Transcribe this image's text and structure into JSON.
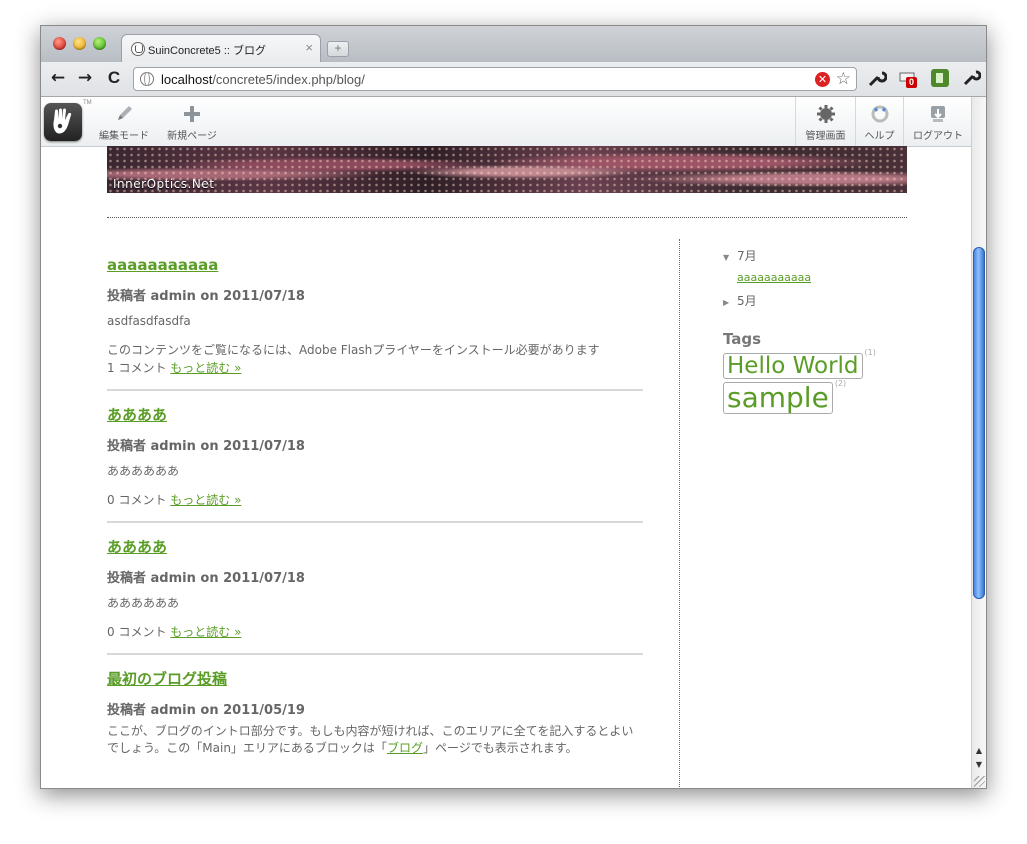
{
  "browser": {
    "tab_title": "SuinConcrete5 :: ブログ",
    "tab_close": "×",
    "new_tab": "+",
    "back": "←",
    "forward": "→",
    "reload": "C",
    "url_host": "localhost",
    "url_path": "/concrete5/index.php/blog/",
    "stop": "✕",
    "star": "☆",
    "badge": "0"
  },
  "c5toolbar": {
    "tm": "TM",
    "edit_mode": "編集モード",
    "new_page": "新規ページ",
    "dashboard": "管理画面",
    "help": "ヘルプ",
    "logout": "ログアウト"
  },
  "header": {
    "caption": "InnerOptics.Net"
  },
  "posts": [
    {
      "title": "aaaaaaaaaaa",
      "meta": "投稿者 admin on 2011/07/18",
      "body": "asdfasdfasdfa",
      "body2": "このコンテンツをご覧になるには、Adobe Flashプライヤーをインストール必要があります",
      "comments": "1 コメント",
      "more": "もっと読む »"
    },
    {
      "title": "ああああ",
      "meta": "投稿者 admin on 2011/07/18",
      "body": "ああああああ",
      "comments": "0 コメント",
      "more": "もっと読む »"
    },
    {
      "title": "ああああ",
      "meta": "投稿者 admin on 2011/07/18",
      "body": "ああああああ",
      "comments": "0 コメント",
      "more": "もっと読む »"
    },
    {
      "title": "最初のブログ投稿",
      "meta": "投稿者 admin on 2011/05/19",
      "body_a": "ここが、ブログのイントロ部分です。もしも内容が短ければ、このエリアに全てを記入するとよいでしょう。この「Main」エリアにあるブロックは「",
      "body_link": "ブログ",
      "body_b": "」ページでも表示されます。"
    }
  ],
  "sidebar": {
    "month_open": "7月",
    "month_open_link": "aaaaaaaaaaa",
    "month_closed": "5月",
    "tags_title": "Tags",
    "tags": [
      {
        "name": "Hello World",
        "count": "(1)"
      },
      {
        "name": "sample",
        "count": "(2)"
      }
    ]
  }
}
